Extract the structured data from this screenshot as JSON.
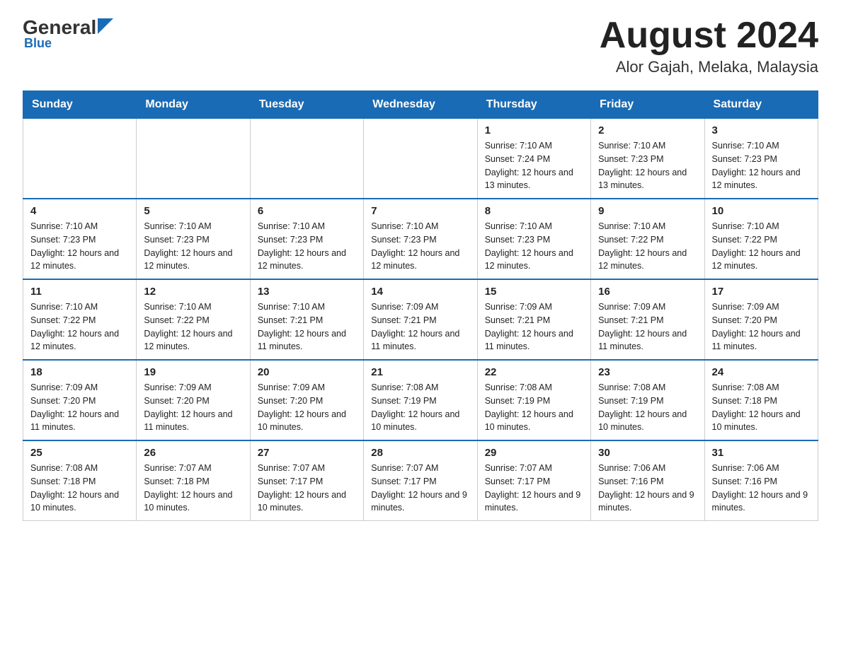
{
  "logo": {
    "name_black": "General",
    "name_blue": "Blue"
  },
  "title": "August 2024",
  "location": "Alor Gajah, Melaka, Malaysia",
  "days_of_week": [
    "Sunday",
    "Monday",
    "Tuesday",
    "Wednesday",
    "Thursday",
    "Friday",
    "Saturday"
  ],
  "weeks": [
    [
      {
        "day": "",
        "info": ""
      },
      {
        "day": "",
        "info": ""
      },
      {
        "day": "",
        "info": ""
      },
      {
        "day": "",
        "info": ""
      },
      {
        "day": "1",
        "info": "Sunrise: 7:10 AM\nSunset: 7:24 PM\nDaylight: 12 hours and 13 minutes."
      },
      {
        "day": "2",
        "info": "Sunrise: 7:10 AM\nSunset: 7:23 PM\nDaylight: 12 hours and 13 minutes."
      },
      {
        "day": "3",
        "info": "Sunrise: 7:10 AM\nSunset: 7:23 PM\nDaylight: 12 hours and 12 minutes."
      }
    ],
    [
      {
        "day": "4",
        "info": "Sunrise: 7:10 AM\nSunset: 7:23 PM\nDaylight: 12 hours and 12 minutes."
      },
      {
        "day": "5",
        "info": "Sunrise: 7:10 AM\nSunset: 7:23 PM\nDaylight: 12 hours and 12 minutes."
      },
      {
        "day": "6",
        "info": "Sunrise: 7:10 AM\nSunset: 7:23 PM\nDaylight: 12 hours and 12 minutes."
      },
      {
        "day": "7",
        "info": "Sunrise: 7:10 AM\nSunset: 7:23 PM\nDaylight: 12 hours and 12 minutes."
      },
      {
        "day": "8",
        "info": "Sunrise: 7:10 AM\nSunset: 7:23 PM\nDaylight: 12 hours and 12 minutes."
      },
      {
        "day": "9",
        "info": "Sunrise: 7:10 AM\nSunset: 7:22 PM\nDaylight: 12 hours and 12 minutes."
      },
      {
        "day": "10",
        "info": "Sunrise: 7:10 AM\nSunset: 7:22 PM\nDaylight: 12 hours and 12 minutes."
      }
    ],
    [
      {
        "day": "11",
        "info": "Sunrise: 7:10 AM\nSunset: 7:22 PM\nDaylight: 12 hours and 12 minutes."
      },
      {
        "day": "12",
        "info": "Sunrise: 7:10 AM\nSunset: 7:22 PM\nDaylight: 12 hours and 12 minutes."
      },
      {
        "day": "13",
        "info": "Sunrise: 7:10 AM\nSunset: 7:21 PM\nDaylight: 12 hours and 11 minutes."
      },
      {
        "day": "14",
        "info": "Sunrise: 7:09 AM\nSunset: 7:21 PM\nDaylight: 12 hours and 11 minutes."
      },
      {
        "day": "15",
        "info": "Sunrise: 7:09 AM\nSunset: 7:21 PM\nDaylight: 12 hours and 11 minutes."
      },
      {
        "day": "16",
        "info": "Sunrise: 7:09 AM\nSunset: 7:21 PM\nDaylight: 12 hours and 11 minutes."
      },
      {
        "day": "17",
        "info": "Sunrise: 7:09 AM\nSunset: 7:20 PM\nDaylight: 12 hours and 11 minutes."
      }
    ],
    [
      {
        "day": "18",
        "info": "Sunrise: 7:09 AM\nSunset: 7:20 PM\nDaylight: 12 hours and 11 minutes."
      },
      {
        "day": "19",
        "info": "Sunrise: 7:09 AM\nSunset: 7:20 PM\nDaylight: 12 hours and 11 minutes."
      },
      {
        "day": "20",
        "info": "Sunrise: 7:09 AM\nSunset: 7:20 PM\nDaylight: 12 hours and 10 minutes."
      },
      {
        "day": "21",
        "info": "Sunrise: 7:08 AM\nSunset: 7:19 PM\nDaylight: 12 hours and 10 minutes."
      },
      {
        "day": "22",
        "info": "Sunrise: 7:08 AM\nSunset: 7:19 PM\nDaylight: 12 hours and 10 minutes."
      },
      {
        "day": "23",
        "info": "Sunrise: 7:08 AM\nSunset: 7:19 PM\nDaylight: 12 hours and 10 minutes."
      },
      {
        "day": "24",
        "info": "Sunrise: 7:08 AM\nSunset: 7:18 PM\nDaylight: 12 hours and 10 minutes."
      }
    ],
    [
      {
        "day": "25",
        "info": "Sunrise: 7:08 AM\nSunset: 7:18 PM\nDaylight: 12 hours and 10 minutes."
      },
      {
        "day": "26",
        "info": "Sunrise: 7:07 AM\nSunset: 7:18 PM\nDaylight: 12 hours and 10 minutes."
      },
      {
        "day": "27",
        "info": "Sunrise: 7:07 AM\nSunset: 7:17 PM\nDaylight: 12 hours and 10 minutes."
      },
      {
        "day": "28",
        "info": "Sunrise: 7:07 AM\nSunset: 7:17 PM\nDaylight: 12 hours and 9 minutes."
      },
      {
        "day": "29",
        "info": "Sunrise: 7:07 AM\nSunset: 7:17 PM\nDaylight: 12 hours and 9 minutes."
      },
      {
        "day": "30",
        "info": "Sunrise: 7:06 AM\nSunset: 7:16 PM\nDaylight: 12 hours and 9 minutes."
      },
      {
        "day": "31",
        "info": "Sunrise: 7:06 AM\nSunset: 7:16 PM\nDaylight: 12 hours and 9 minutes."
      }
    ]
  ]
}
